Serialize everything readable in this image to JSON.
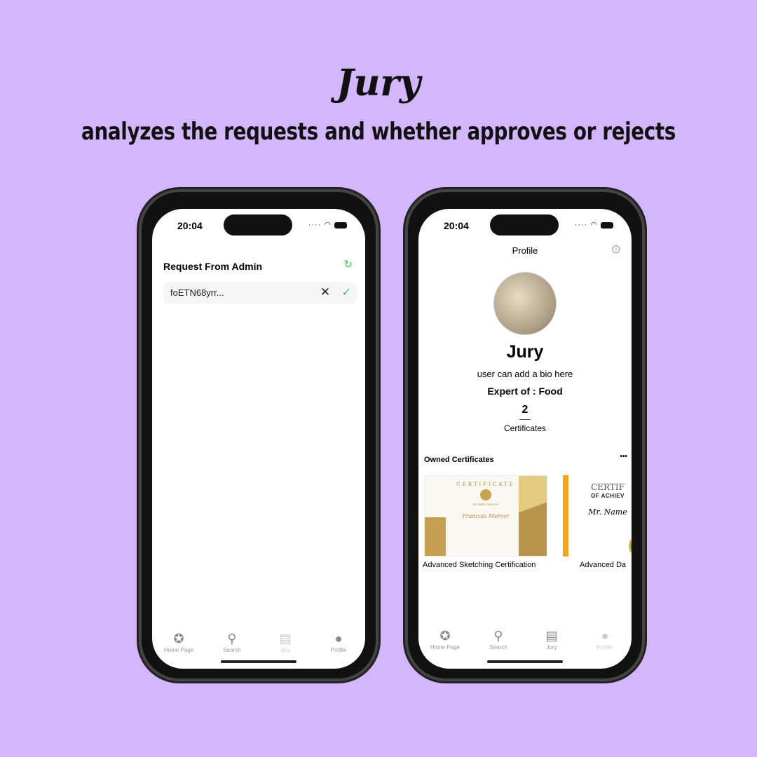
{
  "header": {
    "title": "Jury",
    "subtitle": "analyzes the requests and whether approves or rejects"
  },
  "status_bar": {
    "time": "20:04",
    "signal": "····"
  },
  "left_screen": {
    "title": "Request From Admin",
    "request": {
      "id": "foETN68yrr...",
      "reject_icon": "close-icon",
      "approve_icon": "check-icon"
    },
    "refresh_icon": "refresh-icon"
  },
  "right_screen": {
    "title": "Profile",
    "name": "Jury",
    "bio": "user can add a bio here",
    "expert": "Expert of : Food",
    "cert_count": "2",
    "cert_label": "Certificates",
    "owned_title": "Owned Certificates",
    "more": "•••",
    "certificates": [
      {
        "title": "Advanced Sketching Certification",
        "heading": "CERTIFICATE",
        "sub": "OF PARTICIPATION",
        "recipient": "Francois Mercer"
      },
      {
        "title": "Advanced Da",
        "heading": "CERTIF",
        "sub": "OF ACHIEV",
        "recipient": "Mr. Name"
      }
    ]
  },
  "tabs": [
    {
      "label": "Home Page",
      "icon": "award-icon"
    },
    {
      "label": "Search",
      "icon": "search-icon"
    },
    {
      "label": "Jury",
      "icon": "document-icon"
    },
    {
      "label": "Profile",
      "icon": "person-icon"
    }
  ],
  "colors": {
    "background": "#d3b6fb",
    "approve": "#34c759",
    "active_tab": "#d8c3d6"
  }
}
